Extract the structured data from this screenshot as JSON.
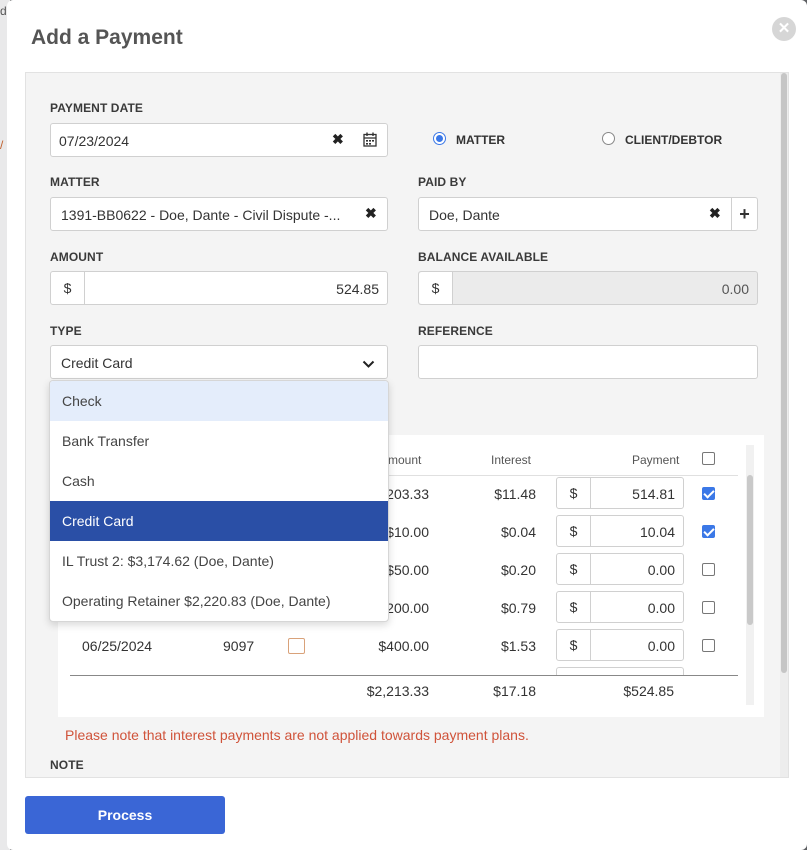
{
  "modal": {
    "title": "Add a Payment",
    "close_icon": "close-icon"
  },
  "form": {
    "payment_date_label": "PAYMENT DATE",
    "payment_date_value": "07/23/2024",
    "radio_matter": "MATTER",
    "radio_client": "CLIENT/DEBTOR",
    "matter_label": "MATTER",
    "matter_value": "1391-BB0622 - Doe, Dante - Civil Dispute -...",
    "paid_by_label": "PAID BY",
    "paid_by_value": "Doe, Dante",
    "amount_label": "AMOUNT",
    "amount_currency": "$",
    "amount_value": "524.85",
    "balance_label": "BALANCE AVAILABLE",
    "balance_currency": "$",
    "balance_value": "0.00",
    "type_label": "TYPE",
    "type_value": "Credit Card",
    "reference_label": "REFERENCE",
    "reference_value": ""
  },
  "dropdown": {
    "options": [
      "Check",
      "Bank Transfer",
      "Cash",
      "Credit Card",
      "IL Trust 2: $3,174.62 (Doe, Dante)",
      "Operating Retainer $2,220.83 (Doe, Dante)"
    ],
    "selected": "Credit Card",
    "hovered": "Check"
  },
  "table": {
    "headers": {
      "amount": "Amount",
      "interest": "Interest",
      "payment": "Payment"
    },
    "rows": [
      {
        "amount": "$203.33",
        "interest": "$11.48",
        "payment": "514.81",
        "checked": true
      },
      {
        "amount": "$10.00",
        "interest": "$0.04",
        "payment": "10.04",
        "checked": true
      },
      {
        "amount": "$50.00",
        "interest": "$0.20",
        "payment": "0.00",
        "checked": false
      },
      {
        "amount": "$200.00",
        "interest": "$0.79",
        "payment": "0.00",
        "checked": false
      },
      {
        "date": "06/25/2024",
        "number": "9097",
        "amount": "$400.00",
        "interest": "$1.53",
        "payment": "0.00",
        "checked": false
      }
    ],
    "currency": "$",
    "totals": {
      "amount": "$2,213.33",
      "interest": "$17.18",
      "payment": "$524.85"
    }
  },
  "note_warning": "Please note that interest payments are not applied towards payment plans.",
  "note_label": "NOTE",
  "process_button": "Process"
}
